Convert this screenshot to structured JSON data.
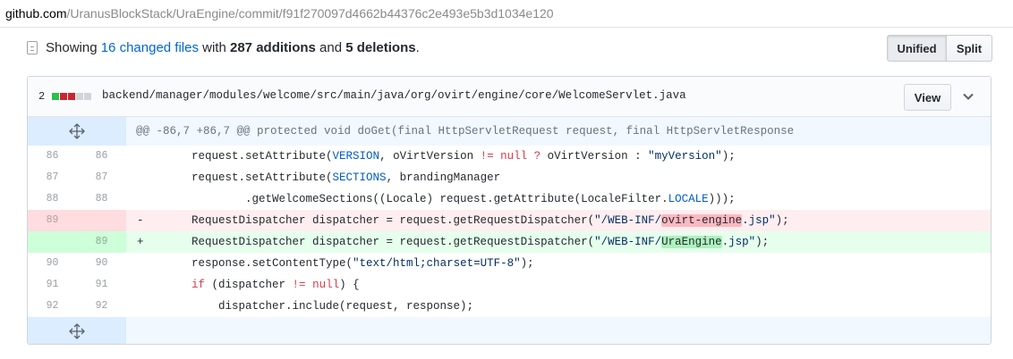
{
  "browser": {
    "url_host": "github.com",
    "url_path": "/UranusBlockStack/UraEngine/commit/f91f270097d4662b44376c2e493e5b3d1034e120"
  },
  "summary": {
    "prefix": "Showing",
    "changed_files": "16 changed files",
    "with": "with",
    "additions": "287 additions",
    "and": "and",
    "deletions": "5 deletions",
    "period": "."
  },
  "view_toggle": {
    "unified": "Unified",
    "split": "Split"
  },
  "file": {
    "change_count": "2",
    "diffstat_colors": [
      "#2cbe4e",
      "#cb2431",
      "#cb2431",
      "#d1d5da",
      "#d1d5da"
    ],
    "path": "backend/manager/modules/welcome/src/main/java/org/ovirt/engine/core/WelcomeServlet.java",
    "view_label": "View",
    "hunk_header": "@@ -86,7 +86,7 @@ protected void doGet(final HttpServletRequest request, final HttpServletResponse",
    "lines": [
      {
        "type": "ctx",
        "old": "86",
        "new": "86",
        "sign": "",
        "tokens": [
          [
            "",
            "        request.setAttribute("
          ],
          [
            "cn",
            "VERSION"
          ],
          [
            "",
            ", oVirtVersion "
          ],
          [
            "kw",
            "!="
          ],
          [
            "",
            ""
          ],
          [
            "kw",
            " null"
          ],
          [
            "kw",
            " ?"
          ],
          [
            "",
            " oVirtVersion : "
          ],
          [
            "s",
            "\"myVersion\""
          ],
          [
            "",
            ");"
          ]
        ]
      },
      {
        "type": "ctx",
        "old": "87",
        "new": "87",
        "sign": "",
        "tokens": [
          [
            "",
            "        request.setAttribute("
          ],
          [
            "cn",
            "SECTIONS"
          ],
          [
            "",
            ", brandingManager"
          ]
        ]
      },
      {
        "type": "ctx",
        "old": "88",
        "new": "88",
        "sign": "",
        "tokens": [
          [
            "",
            "                .getWelcomeSections((Locale) request.getAttribute(LocaleFilter."
          ],
          [
            "cn",
            "LOCALE"
          ],
          [
            "",
            ")));"
          ]
        ]
      },
      {
        "type": "del",
        "old": "89",
        "new": "",
        "sign": "-",
        "tokens": [
          [
            "",
            "        RequestDispatcher dispatcher = request.getRequestDispatcher("
          ],
          [
            "s",
            "\"/WEB-INF/"
          ],
          [
            "hl-del",
            "ovirt-engine"
          ],
          [
            "s",
            ".jsp\""
          ],
          [
            "",
            ");"
          ]
        ]
      },
      {
        "type": "add",
        "old": "",
        "new": "89",
        "sign": "+",
        "tokens": [
          [
            "",
            "        RequestDispatcher dispatcher = request.getRequestDispatcher("
          ],
          [
            "s",
            "\"/WEB-INF/"
          ],
          [
            "hl-add",
            "UraEngine"
          ],
          [
            "s",
            ".jsp\""
          ],
          [
            "",
            ");"
          ]
        ]
      },
      {
        "type": "ctx",
        "old": "90",
        "new": "90",
        "sign": "",
        "tokens": [
          [
            "",
            "        response.setContentType("
          ],
          [
            "s",
            "\"text/html;charset=UTF-8\""
          ],
          [
            "",
            ");"
          ]
        ]
      },
      {
        "type": "ctx",
        "old": "91",
        "new": "91",
        "sign": "",
        "tokens": [
          [
            "kw",
            "        if"
          ],
          [
            "",
            " (dispatcher "
          ],
          [
            "kw",
            "!="
          ],
          [
            "kw",
            " null"
          ],
          [
            "",
            ") {"
          ]
        ]
      },
      {
        "type": "ctx",
        "old": "92",
        "new": "92",
        "sign": "",
        "tokens": [
          [
            "",
            "            dispatcher.include(request, response);"
          ]
        ]
      }
    ]
  }
}
